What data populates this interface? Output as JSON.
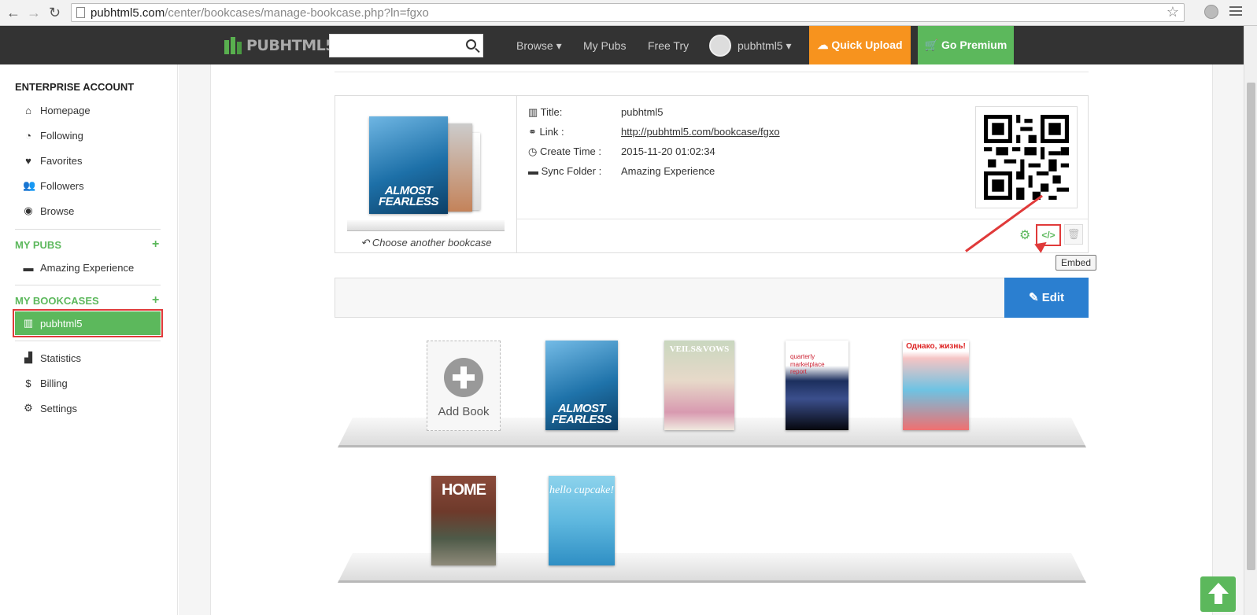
{
  "browser": {
    "url_domain": "pubhtml5.com",
    "url_path": "/center/bookcases/manage-bookcase.php?ln=fgxo"
  },
  "topnav": {
    "logo": "PUBHTML5",
    "browse": "Browse",
    "my_pubs": "My Pubs",
    "free_try": "Free Try",
    "username": "pubhtml5",
    "quick_upload": "Quick Upload",
    "go_premium": "Go Premium",
    "accent_upload": "#f7931e",
    "accent_premium": "#5cb85c"
  },
  "sidebar": {
    "account_heading": "ENTERPRISE ACCOUNT",
    "account_items": [
      {
        "label": "Homepage",
        "icon": "home-icon"
      },
      {
        "label": "Following",
        "icon": "rss-icon"
      },
      {
        "label": "Favorites",
        "icon": "heart-icon"
      },
      {
        "label": "Followers",
        "icon": "users-icon"
      },
      {
        "label": "Browse",
        "icon": "eye-icon"
      }
    ],
    "pubs_heading": "MY PUBS",
    "pubs_items": [
      {
        "label": "Amazing Experience",
        "icon": "folder-icon"
      }
    ],
    "bookcases_heading": "MY BOOKCASES",
    "bookcases_items": [
      {
        "label": "pubhtml5",
        "icon": "bookcase-icon"
      }
    ],
    "other_items": [
      {
        "label": "Statistics",
        "icon": "bar-chart-icon"
      },
      {
        "label": "Billing",
        "icon": "dollar-icon"
      },
      {
        "label": "Settings",
        "icon": "gear-icon"
      }
    ]
  },
  "bookcase": {
    "choose_another": "Choose another bookcase",
    "title_label": "Title:",
    "title_value": "pubhtml5",
    "link_label": "Link :",
    "link_value": "http://pubhtml5.com/bookcase/fgxo",
    "time_label": "Create Time :",
    "time_value": "2015-11-20 01:02:34",
    "folder_label": "Sync Folder :",
    "folder_value": "Amazing Experience",
    "embed_tooltip": "Embed",
    "edit_label": "Edit"
  },
  "shelf": {
    "add_book": "Add Book",
    "books": [
      {
        "cover_text": "ALMOST FEARLESS"
      },
      {
        "cover_text": "VEILS&VOWS"
      },
      {
        "cover_text": "quarterly marketplace report"
      },
      {
        "cover_text": "Однако, жизнь!"
      },
      {
        "cover_text": "HOME"
      },
      {
        "cover_text": "hello cupcake!"
      }
    ]
  }
}
